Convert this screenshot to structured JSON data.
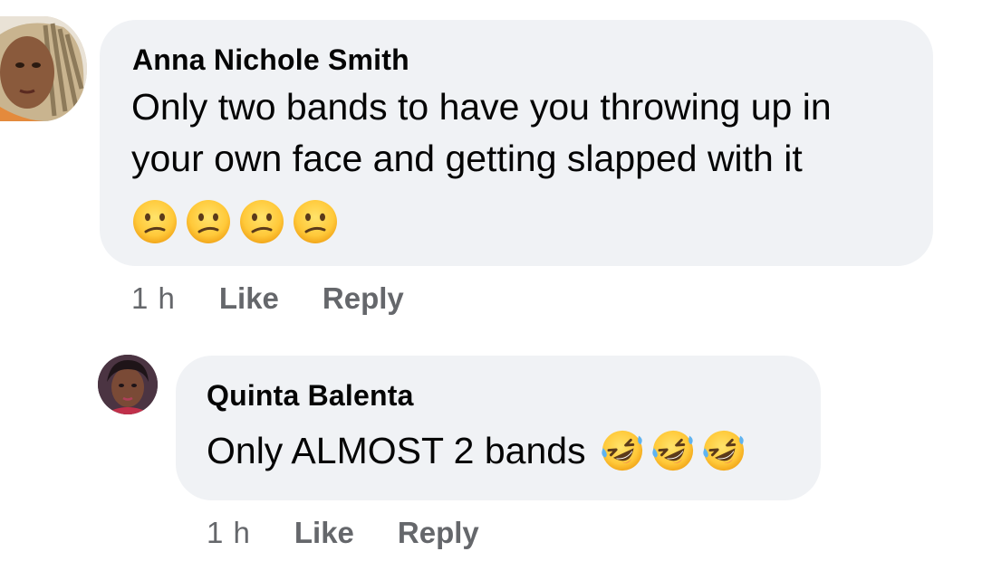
{
  "comments": [
    {
      "author": "Anna Nichole Smith",
      "text_line1": "Only two bands to have you throwing up in",
      "text_line2": "your own face and getting slapped with it",
      "emojis": [
        "confused-face",
        "confused-face",
        "confused-face",
        "confused-face"
      ],
      "time": "1 h",
      "like_label": "Like",
      "reply_label": "Reply"
    },
    {
      "author": "Quinta Balenta",
      "text": "Only ALMOST 2 bands",
      "emojis": [
        "rolling-on-floor-laughing",
        "rolling-on-floor-laughing",
        "rolling-on-floor-laughing"
      ],
      "time": "1 h",
      "like_label": "Like",
      "reply_label": "Reply"
    }
  ],
  "colors": {
    "bubble_bg": "#f0f2f5",
    "meta_text": "#65676b",
    "body_text": "#050505"
  }
}
